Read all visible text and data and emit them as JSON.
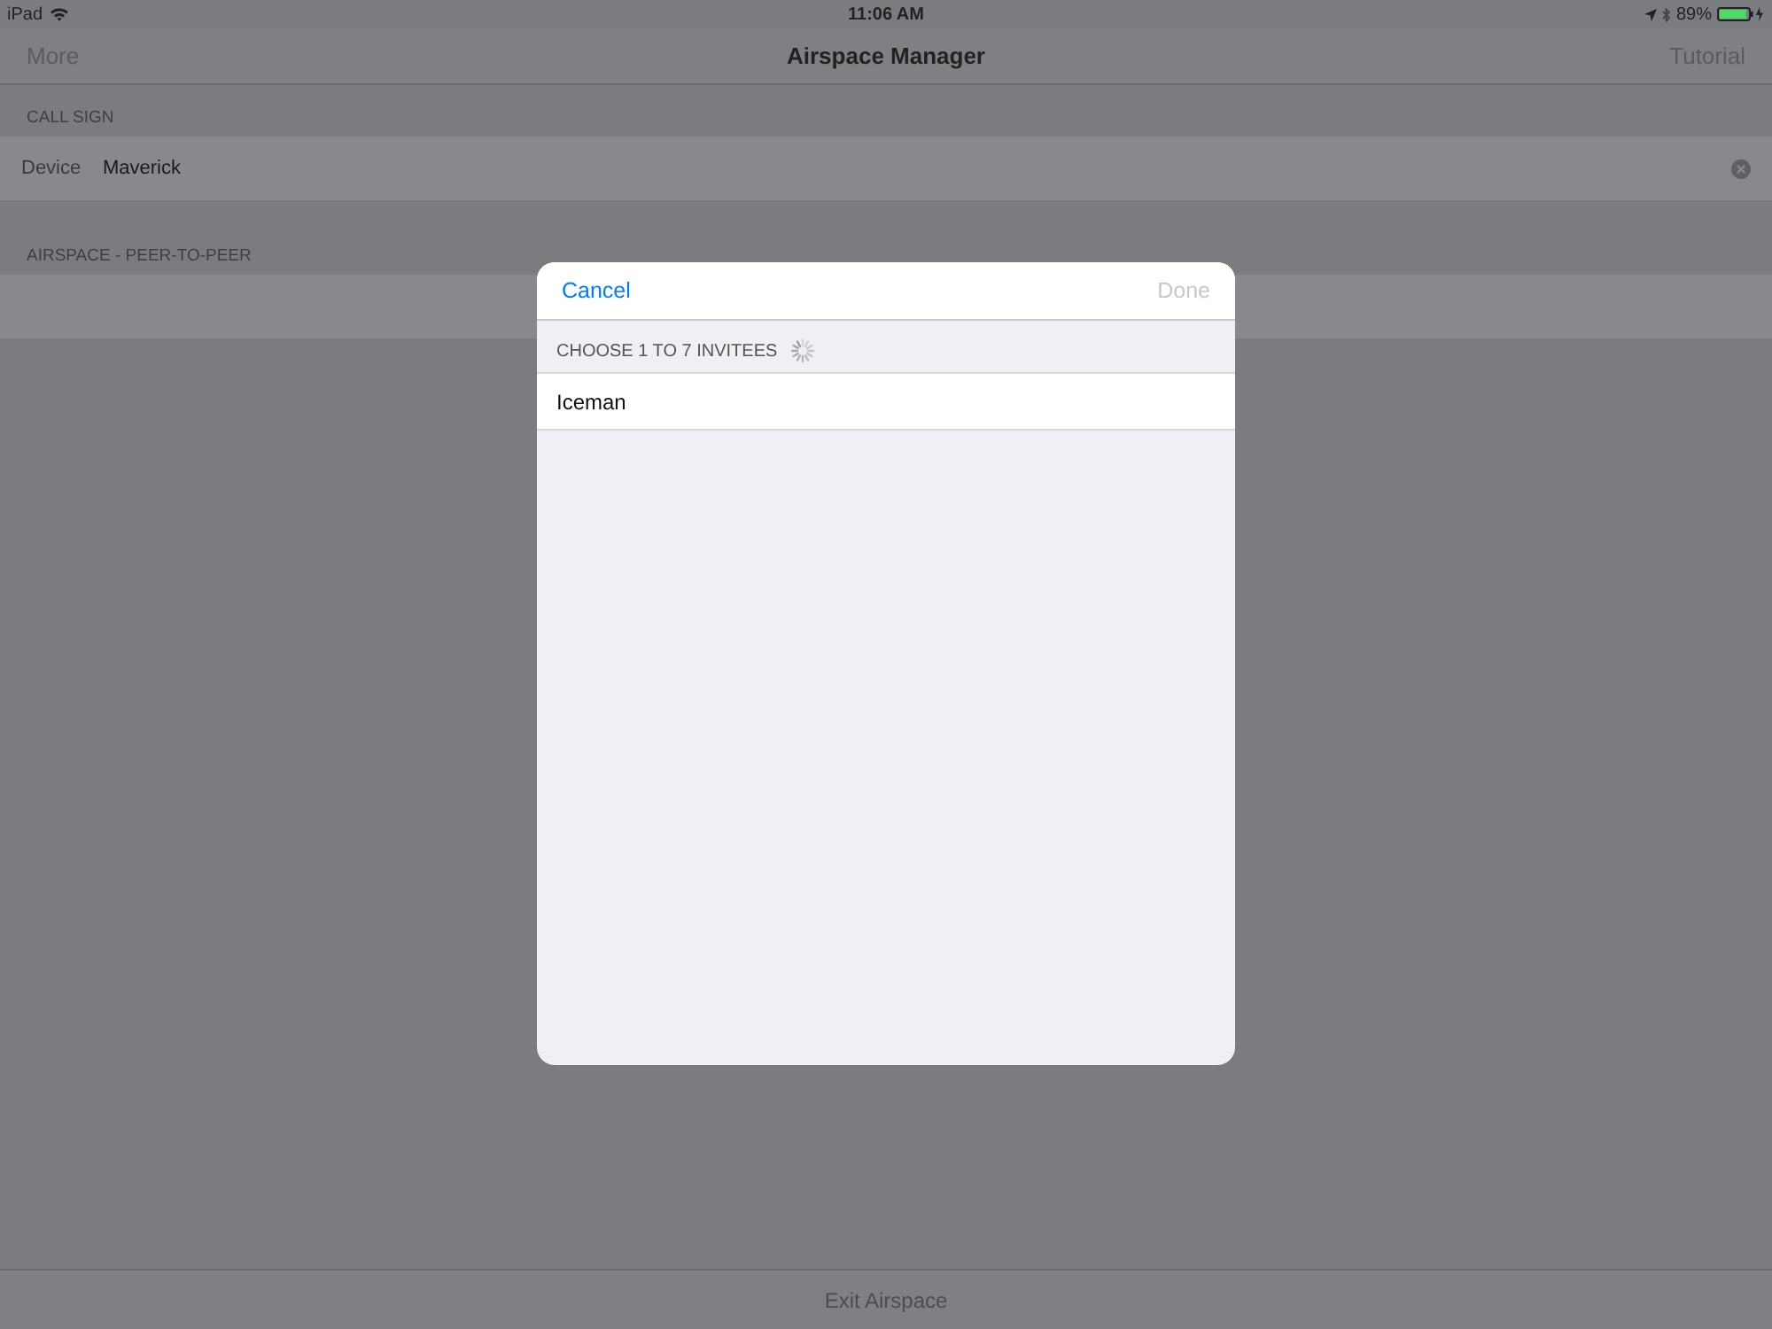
{
  "status_bar": {
    "device": "iPad",
    "time": "11:06 AM",
    "battery": "89%"
  },
  "nav_bar": {
    "left": "More",
    "title": "Airspace Manager",
    "right": "Tutorial"
  },
  "sections": [
    {
      "header": "CALL SIGN",
      "rows": [
        {
          "label": "Device",
          "value": "Maverick"
        }
      ]
    },
    {
      "header": "AIRSPACE - PEER-TO-PEER",
      "rows": [
        {}
      ]
    }
  ],
  "toolbar": {
    "button": "Exit Airspace"
  },
  "dialog": {
    "cancel": "Cancel",
    "done": {
      "label": "Done",
      "disabled": true
    },
    "section_header": "CHOOSE 1 TO 7 INVITEES",
    "loading": true,
    "rows": [
      {
        "label": "Iceman"
      }
    ]
  }
}
